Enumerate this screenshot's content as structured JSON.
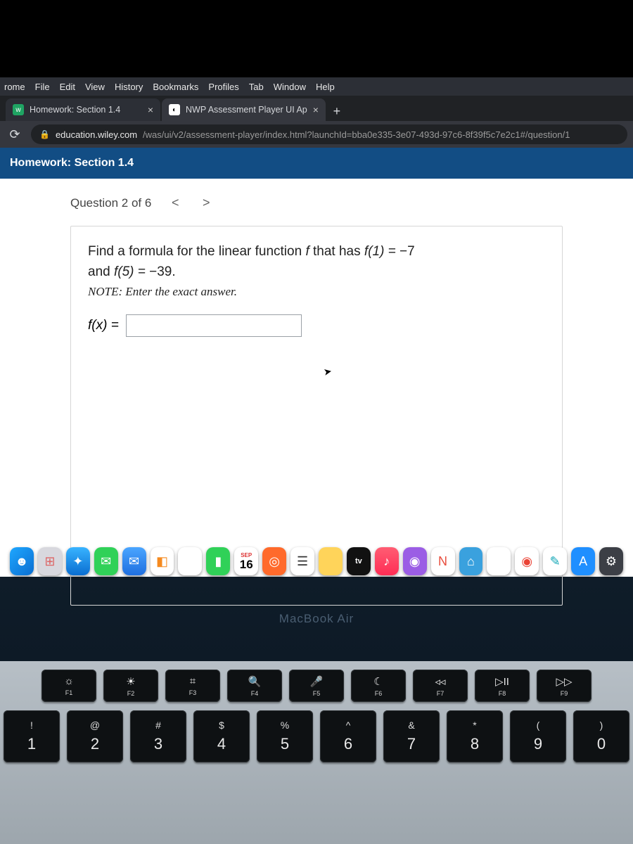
{
  "menubar": [
    "rome",
    "File",
    "Edit",
    "View",
    "History",
    "Bookmarks",
    "Profiles",
    "Tab",
    "Window",
    "Help"
  ],
  "tabs": [
    {
      "title": "Homework: Section 1.4",
      "active": false
    },
    {
      "title": "NWP Assessment Player UI Ap",
      "active": true
    }
  ],
  "address": {
    "host": "education.wiley.com",
    "path": "/was/ui/v2/assessment-player/index.html?launchId=bba0e335-3e07-493d-97c6-8f39f5c7e2c1#/question/1"
  },
  "wiley": {
    "title": "Homework: Section 1.4"
  },
  "question": {
    "pager": "Question 2 of 6",
    "prompt_line1_a": "Find a formula for the linear function ",
    "prompt_line1_b": " that has ",
    "f1_lhs": "f(1) = ",
    "f1_rhs": "−7",
    "prompt_line2_a": "and ",
    "f5_lhs": "f(5) = ",
    "f5_rhs": "−39.",
    "note": "NOTE: Enter the exact answer.",
    "answer_label": "f(x) =",
    "answer_value": ""
  },
  "calendar": {
    "month": "SEP",
    "day": "16"
  },
  "tv_label": "tv",
  "macbook": "MacBook Air",
  "fkeys": [
    {
      "sym": "☼",
      "lab": "F1"
    },
    {
      "sym": "☀",
      "lab": "F2"
    },
    {
      "sym": "⌗",
      "lab": "F3"
    },
    {
      "sym": "🔍",
      "lab": "F4"
    },
    {
      "sym": "🎤",
      "lab": "F5"
    },
    {
      "sym": "☾",
      "lab": "F6"
    },
    {
      "sym": "◃◃",
      "lab": "F7"
    },
    {
      "sym": "▷II",
      "lab": "F8"
    },
    {
      "sym": "▷▷",
      "lab": "F9"
    }
  ],
  "numkeys": [
    {
      "top": "!",
      "bot": "1"
    },
    {
      "top": "@",
      "bot": "2"
    },
    {
      "top": "#",
      "bot": "3"
    },
    {
      "top": "$",
      "bot": "4"
    },
    {
      "top": "%",
      "bot": "5"
    },
    {
      "top": "^",
      "bot": "6"
    },
    {
      "top": "&",
      "bot": "7"
    },
    {
      "top": "*",
      "bot": "8"
    },
    {
      "top": "(",
      "bot": "9"
    },
    {
      "top": ")",
      "bot": "0"
    }
  ]
}
